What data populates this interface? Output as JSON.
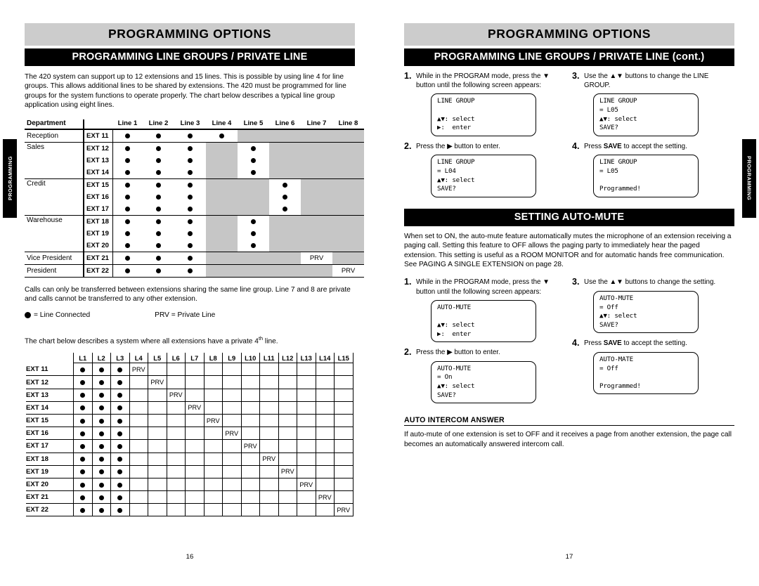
{
  "left_page": {
    "title": "PROGRAMMING OPTIONS",
    "section": "PROGRAMMING LINE GROUPS / PRIVATE LINE",
    "intro": "The 420 system can support up to 12 extensions and 15 lines. This is possible by using line 4 for line groups. This allows additional lines to be shared by extensions. The 420 must be programmed for line groups for the system functions to operate properly. The chart below describes a typical line group application using eight lines.",
    "table1": {
      "header": [
        "Department",
        "",
        "Line 1",
        "Line 2",
        "Line 3",
        "Line 4",
        "Line 5",
        "Line 6",
        "Line 7",
        "Line 8"
      ],
      "rows": [
        {
          "dept": "Reception",
          "ext": "EXT 11",
          "cells": [
            "dot",
            "dot",
            "dot",
            "dot",
            "shade",
            "shade",
            "shade",
            "shade"
          ],
          "group_end": true,
          "dept_rowspan": 1
        },
        {
          "dept": "Sales",
          "ext": "EXT 12",
          "cells": [
            "dot",
            "dot",
            "dot",
            "shade",
            "dot",
            "shade",
            "shade",
            "shade"
          ],
          "dept_rowspan": 3
        },
        {
          "dept": "",
          "ext": "EXT 13",
          "cells": [
            "dot",
            "dot",
            "dot",
            "shade",
            "dot",
            "shade",
            "shade",
            "shade"
          ]
        },
        {
          "dept": "",
          "ext": "EXT 14",
          "cells": [
            "dot",
            "dot",
            "dot",
            "shade",
            "dot",
            "shade",
            "shade",
            "shade"
          ],
          "group_end": true
        },
        {
          "dept": "Credit",
          "ext": "EXT 15",
          "cells": [
            "dot",
            "dot",
            "dot",
            "shade",
            "shade",
            "dot",
            "shade",
            "shade"
          ],
          "dept_rowspan": 3
        },
        {
          "dept": "",
          "ext": "EXT 16",
          "cells": [
            "dot",
            "dot",
            "dot",
            "shade",
            "shade",
            "dot",
            "shade",
            "shade"
          ]
        },
        {
          "dept": "",
          "ext": "EXT 17",
          "cells": [
            "dot",
            "dot",
            "dot",
            "shade",
            "shade",
            "dot",
            "shade",
            "shade"
          ],
          "group_end": true
        },
        {
          "dept": "Warehouse",
          "ext": "EXT 18",
          "cells": [
            "dot",
            "dot",
            "dot",
            "shade",
            "dot",
            "shade",
            "shade",
            "shade"
          ],
          "dept_rowspan": 3
        },
        {
          "dept": "",
          "ext": "EXT 19",
          "cells": [
            "dot",
            "dot",
            "dot",
            "shade",
            "dot",
            "shade",
            "shade",
            "shade"
          ]
        },
        {
          "dept": "",
          "ext": "EXT 20",
          "cells": [
            "dot",
            "dot",
            "dot",
            "shade",
            "dot",
            "shade",
            "shade",
            "shade"
          ],
          "group_end": true
        },
        {
          "dept": "Vice President",
          "ext": "EXT 21",
          "cells": [
            "dot",
            "dot",
            "dot",
            "shade",
            "shade",
            "shade",
            "PRV",
            "shade"
          ],
          "group_end": true,
          "dept_rowspan": 1
        },
        {
          "dept": "President",
          "ext": "EXT 22",
          "cells": [
            "dot",
            "dot",
            "dot",
            "shade",
            "shade",
            "shade",
            "shade",
            "PRV"
          ],
          "group_end": true,
          "dept_rowspan": 1
        }
      ]
    },
    "note": "Calls can only be transferred between extensions sharing the same line group. Line 7 and 8 are private and calls cannot be transferred to any other extension.",
    "legend": {
      "dot_label": "= Line Connected",
      "prv_label": "PRV = Private Line"
    },
    "intro2_a": "The chart below describes a system where all extensions have a private 4",
    "intro2_sup": "th",
    "intro2_b": " line.",
    "table2": {
      "header": [
        "",
        "L1",
        "L2",
        "L3",
        "L4",
        "L5",
        "L6",
        "L7",
        "L8",
        "L9",
        "L10",
        "L11",
        "L12",
        "L13",
        "L14",
        "L15"
      ],
      "rows": [
        {
          "label": "EXT 11",
          "cells": [
            "dot",
            "dot",
            "dot",
            "PRV",
            "",
            "",
            "",
            "",
            "",
            "",
            "",
            "",
            "",
            "",
            ""
          ]
        },
        {
          "label": "EXT 12",
          "cells": [
            "dot",
            "dot",
            "dot",
            "",
            "PRV",
            "",
            "",
            "",
            "",
            "",
            "",
            "",
            "",
            "",
            ""
          ]
        },
        {
          "label": "EXT 13",
          "cells": [
            "dot",
            "dot",
            "dot",
            "",
            "",
            "PRV",
            "",
            "",
            "",
            "",
            "",
            "",
            "",
            "",
            ""
          ]
        },
        {
          "label": "EXT 14",
          "cells": [
            "dot",
            "dot",
            "dot",
            "",
            "",
            "",
            "PRV",
            "",
            "",
            "",
            "",
            "",
            "",
            "",
            ""
          ]
        },
        {
          "label": "EXT 15",
          "cells": [
            "dot",
            "dot",
            "dot",
            "",
            "",
            "",
            "",
            "PRV",
            "",
            "",
            "",
            "",
            "",
            "",
            ""
          ]
        },
        {
          "label": "EXT 16",
          "cells": [
            "dot",
            "dot",
            "dot",
            "",
            "",
            "",
            "",
            "",
            "PRV",
            "",
            "",
            "",
            "",
            "",
            ""
          ]
        },
        {
          "label": "EXT 17",
          "cells": [
            "dot",
            "dot",
            "dot",
            "",
            "",
            "",
            "",
            "",
            "",
            "PRV",
            "",
            "",
            "",
            "",
            ""
          ]
        },
        {
          "label": "EXT 18",
          "cells": [
            "dot",
            "dot",
            "dot",
            "",
            "",
            "",
            "",
            "",
            "",
            "",
            "PRV",
            "",
            "",
            "",
            ""
          ]
        },
        {
          "label": "EXT 19",
          "cells": [
            "dot",
            "dot",
            "dot",
            "",
            "",
            "",
            "",
            "",
            "",
            "",
            "",
            "PRV",
            "",
            "",
            ""
          ]
        },
        {
          "label": "EXT 20",
          "cells": [
            "dot",
            "dot",
            "dot",
            "",
            "",
            "",
            "",
            "",
            "",
            "",
            "",
            "",
            "PRV",
            "",
            ""
          ]
        },
        {
          "label": "EXT 21",
          "cells": [
            "dot",
            "dot",
            "dot",
            "",
            "",
            "",
            "",
            "",
            "",
            "",
            "",
            "",
            "",
            "PRV",
            ""
          ]
        },
        {
          "label": "EXT 22",
          "cells": [
            "dot",
            "dot",
            "dot",
            "",
            "",
            "",
            "",
            "",
            "",
            "",
            "",
            "",
            "",
            "",
            "PRV"
          ]
        }
      ]
    },
    "page_number": "16",
    "thumb_tab": "PROGRAMMING"
  },
  "right_page": {
    "title": "PROGRAMMING OPTIONS",
    "section_a": "PROGRAMMING LINE GROUPS / PRIVATE LINE",
    "section_cont": " (cont.)",
    "linegroup_steps": {
      "step1_num": "1.",
      "step1_text": "While in the PROGRAM mode, press the ▼ button until the following screen appears:",
      "lcd1": [
        "LINE GROUP",
        "",
        "▲▼: select",
        "▶:  enter"
      ],
      "step2_num": "2.",
      "step2_text_a": "Press the ",
      "step2_arrow": "▶",
      "step2_text_b": " button to enter.",
      "lcd2": [
        "LINE GROUP",
        "= L04",
        "▲▼: select",
        "SAVE?"
      ],
      "step3_num": "3.",
      "step3_text": "Use the ▲▼ buttons to change the LINE GROUP.",
      "lcd3": [
        "LINE GROUP",
        "= L05",
        "▲▼: select",
        "SAVE?"
      ],
      "step4_num": "4.",
      "step4_text_a": "Press ",
      "step4_bold": "SAVE",
      "step4_text_b": " to accept the setting.",
      "lcd4": [
        "LINE GROUP",
        "= L05",
        "",
        "Programmed!"
      ]
    },
    "automute_section": "SETTING AUTO-MUTE",
    "automute_body": "When set to ON, the auto-mute feature automatically mutes the microphone of an extension receiving a paging call. Setting this feature to OFF allows the paging party to immediately hear the paged extension. This setting is useful as a ROOM MONITOR and for automatic hands free communication. See PAGING A SINGLE EXTENSION on page 28.",
    "automute_steps": {
      "step1_num": "1.",
      "step1_text": "While in the PROGRAM mode, press the ▼ button until the following screen appears:",
      "lcd1": [
        "AUTO-MUTE",
        "",
        "▲▼: select",
        "▶:  enter"
      ],
      "step2_num": "2.",
      "step2_text_a": "Press the ",
      "step2_arrow": "▶",
      "step2_text_b": " button to enter.",
      "lcd2": [
        "AUTO-MUTE",
        "= On",
        "▲▼: select",
        "SAVE?"
      ],
      "step3_num": "3.",
      "step3_text": "Use the ▲▼ buttons to change the setting.",
      "lcd3": [
        "AUTO-MUTE",
        "= Off",
        "▲▼: select",
        "SAVE?"
      ],
      "step4_num": "4.",
      "step4_text_a": "Press ",
      "step4_bold": "SAVE",
      "step4_text_b": " to accept the setting.",
      "lcd4": [
        "AUTO-MATE",
        "= Off",
        "",
        "Programmed!"
      ]
    },
    "intercom_heading": "AUTO INTERCOM ANSWER",
    "intercom_body": "If auto-mute of one extension is set to OFF and it receives a page from another extension, the page call becomes an automatically answered intercom call.",
    "page_number": "17",
    "thumb_tab": "PROGRAMMING"
  },
  "colors": {
    "shade": "#c6c6c6",
    "title_bar": "#cccccc",
    "section_bar": "#000000"
  }
}
